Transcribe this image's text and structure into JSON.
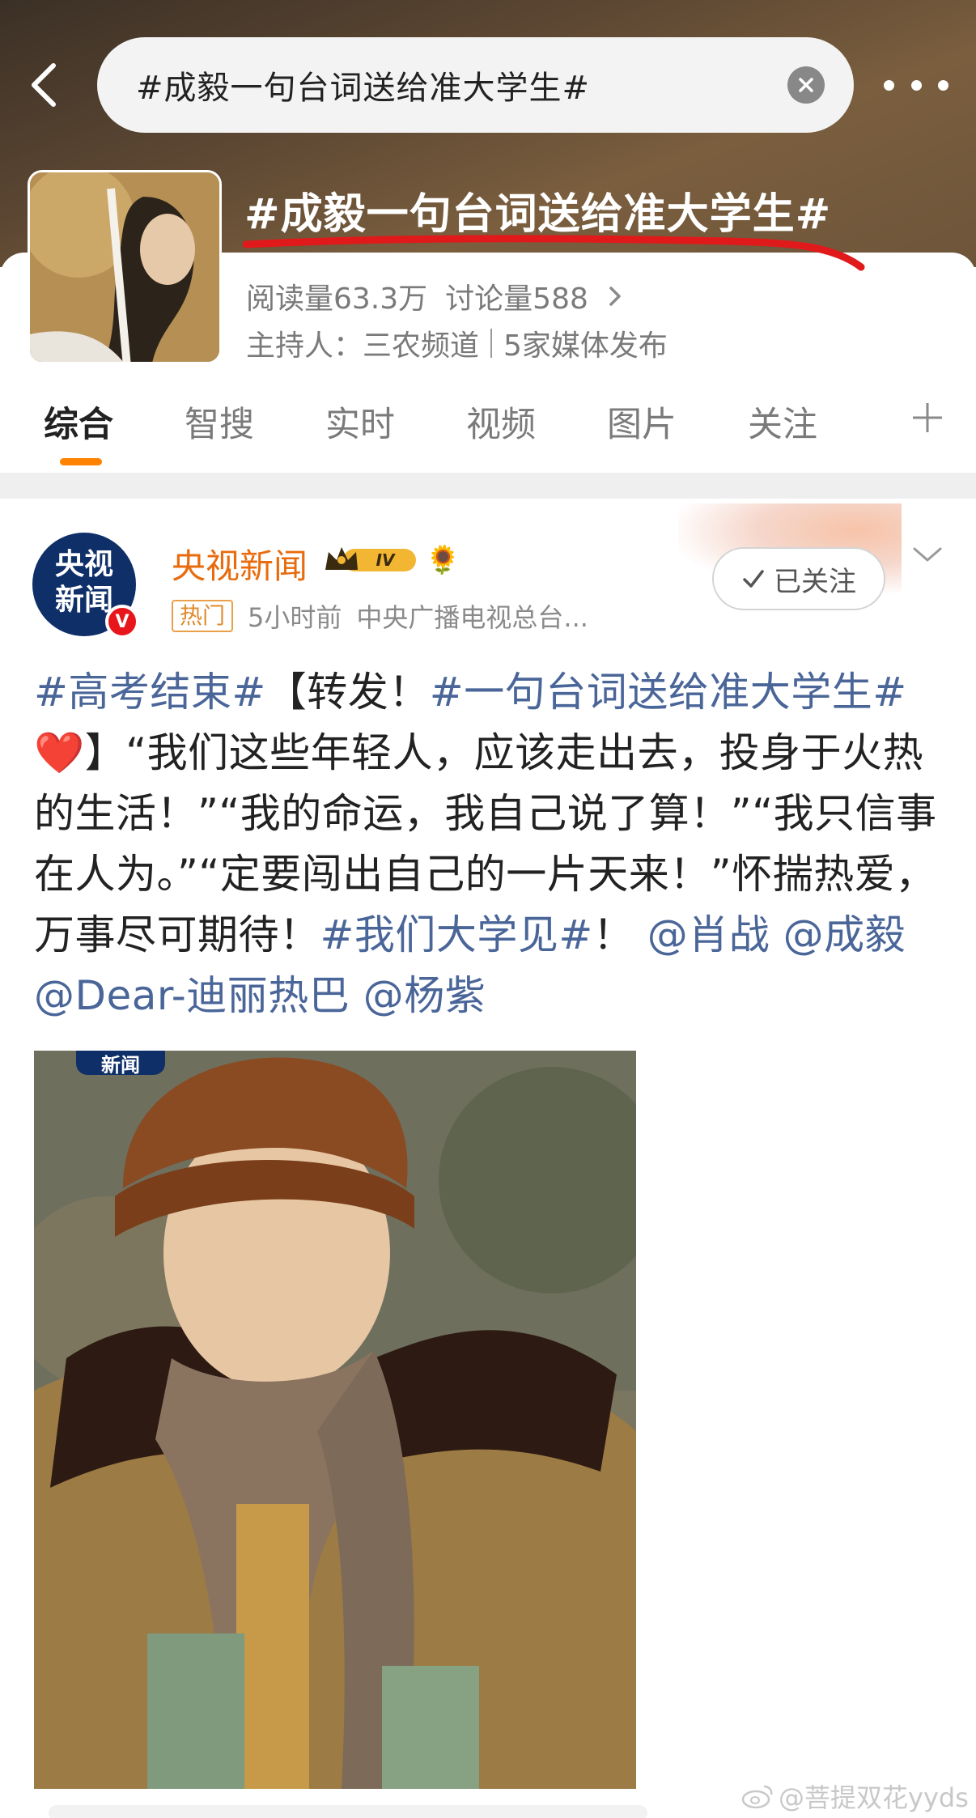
{
  "header": {
    "search_value": "#成毅一句台词送给准大学生#",
    "back_icon": "chevron-left-icon",
    "clear_icon": "close-circle-icon",
    "more_icon": "more-dots-icon"
  },
  "topic": {
    "title": "#成毅一句台词送给准大学生#",
    "reads_label": "阅读量63.3万",
    "discuss_label": "讨论量588",
    "host_label": "主持人：三农频道",
    "media_label": "5家媒体发布"
  },
  "tabs": [
    {
      "label": "综合",
      "active": true
    },
    {
      "label": "智搜",
      "active": false
    },
    {
      "label": "实时",
      "active": false
    },
    {
      "label": "视频",
      "active": false
    },
    {
      "label": "图片",
      "active": false
    },
    {
      "label": "关注",
      "active": false
    }
  ],
  "post": {
    "avatar_text": "央视\n新闻",
    "verified_badge": "V",
    "author": "央视新闻",
    "vip_level": "IV",
    "hot_tag": "热门",
    "time": "5小时前",
    "source": "中央广播电视总台...",
    "follow_label": "已关注",
    "text_parts": {
      "t1": "#高考结束#",
      "t2": "【转发！",
      "t3": "#一句台词送给准大学生#",
      "t4": "❤️",
      "t5": "】“我们这些年轻人，应该走出去，投身于火热的生活！”“我的命运，我自己说了算！”“我只信事在人为。”“定要闯出自己的一片天来！”怀揣热爱，万事尽可期待！",
      "t6": "#我们大学见#",
      "t7": "！",
      "t8": "@肖战",
      "t9": "@成毅",
      "t10": "@Dear-迪丽热巴",
      "t11": "@杨紫"
    },
    "media_tag": "新闻"
  },
  "watermark": "@菩提双花yyds",
  "colors": {
    "accent": "#ff8200",
    "link": "#4a6699",
    "author": "#e86b0d",
    "underline": "#e01a1a"
  }
}
